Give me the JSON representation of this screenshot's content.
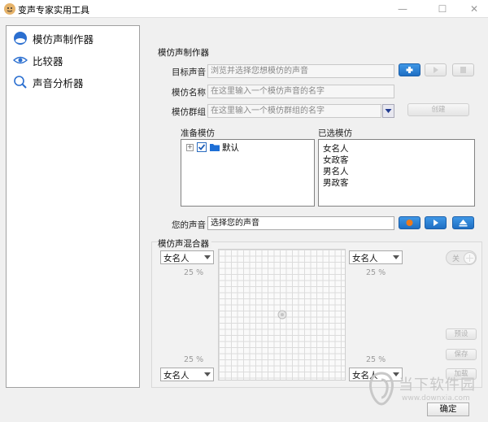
{
  "window": {
    "title": "变声专家实用工具"
  },
  "sidebar": {
    "items": [
      {
        "label": "模仿声制作器",
        "icon": "avatar-face-icon"
      },
      {
        "label": "比较器",
        "icon": "eye-icon"
      },
      {
        "label": "声音分析器",
        "icon": "magnifier-icon"
      }
    ]
  },
  "maker": {
    "section_title": "模仿声制作器",
    "target_label": "目标声音",
    "target_placeholder": "浏览并选择您想模仿的声音",
    "name_label": "模仿名称",
    "name_placeholder": "在这里输入一个模仿声音的名字",
    "group_label": "模仿群组",
    "group_placeholder": "在这里输入一个模仿群组的名字",
    "create_label": "创建",
    "prepare_label": "准备模仿",
    "selected_label": "已选模仿",
    "tree_node": "默认",
    "selected_items": [
      "女名人",
      "女政客",
      "男名人",
      "男政客"
    ],
    "your_voice_label": "您的声音",
    "your_voice_value": "选择您的声音"
  },
  "mixer": {
    "section_title": "模仿声混合器",
    "combo_tl": "女名人",
    "combo_tr": "女名人",
    "combo_bl": "女名人",
    "combo_br": "女名人",
    "pct_tl": "25 %",
    "pct_tr": "25 %",
    "pct_bl": "25 %",
    "pct_br": "25 %",
    "toggle_label": "关",
    "side_buttons": [
      "预设",
      "保存",
      "加载"
    ]
  },
  "footer": {
    "ok_label": "确定"
  },
  "watermark": {
    "text1": "当下软件园",
    "text2": "www.downxia.com"
  }
}
